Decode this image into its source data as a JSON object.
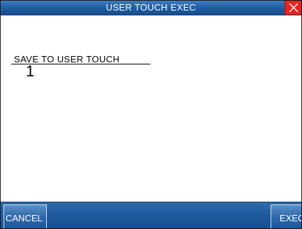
{
  "window": {
    "title": "USER TOUCH EXEC"
  },
  "main": {
    "save_label": "SAVE TO USER TOUCH",
    "touch_number": "1"
  },
  "softkeys": {
    "cancel_label": "CANCEL",
    "exec_label": "EXEC"
  },
  "icons": {
    "close": "close-icon"
  },
  "colors": {
    "title_bar": "#1e5a9e",
    "close_button": "#e8231c",
    "background": "#ffffff"
  }
}
